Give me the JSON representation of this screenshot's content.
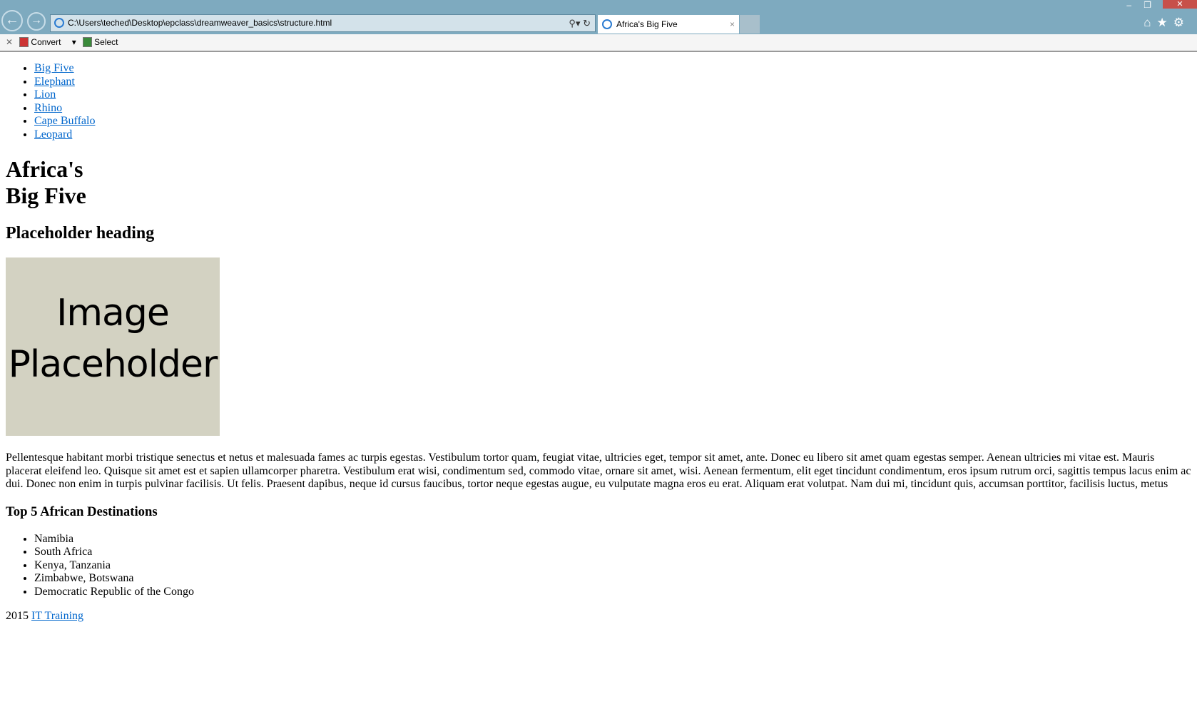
{
  "browser": {
    "address": "C:\\Users\\teched\\Desktop\\epclass\\dreamweaver_basics\\structure.html",
    "tab_title": "Africa's Big Five",
    "close_label": "×"
  },
  "toolbar": {
    "convert": "Convert",
    "select": "Select"
  },
  "nav": [
    {
      "label": "Big Five"
    },
    {
      "label": "Elephant"
    },
    {
      "label": "Lion"
    },
    {
      "label": "Rhino"
    },
    {
      "label": "Cape Buffalo"
    },
    {
      "label": "Leopard"
    }
  ],
  "page": {
    "title_line1": "Africa's",
    "title_line2": "Big Five",
    "subheading": "Placeholder heading",
    "image_line1": "Image",
    "image_line2": "Placeholder",
    "paragraph": "Pellentesque habitant morbi tristique senectus et netus et malesuada fames ac turpis egestas. Vestibulum tortor quam, feugiat vitae, ultricies eget, tempor sit amet, ante. Donec eu libero sit amet quam egestas semper. Aenean ultricies mi vitae est. Mauris placerat eleifend leo. Quisque sit amet est et sapien ullamcorper pharetra. Vestibulum erat wisi, condimentum sed, commodo vitae, ornare sit amet, wisi. Aenean fermentum, elit eget tincidunt condimentum, eros ipsum rutrum orci, sagittis tempus lacus enim ac dui. Donec non enim in turpis pulvinar facilisis. Ut felis. Praesent dapibus, neque id cursus faucibus, tortor neque egestas augue, eu vulputate magna eros eu erat. Aliquam erat volutpat. Nam dui mi, tincidunt quis, accumsan porttitor, facilisis luctus, metus",
    "destinations_heading": "Top 5 African Destinations",
    "destinations": [
      "Namibia",
      "South Africa",
      "Kenya, Tanzania",
      "Zimbabwe, Botswana",
      "Democratic Republic of the Congo"
    ],
    "footer_year": "2015",
    "footer_link": "IT Training"
  }
}
